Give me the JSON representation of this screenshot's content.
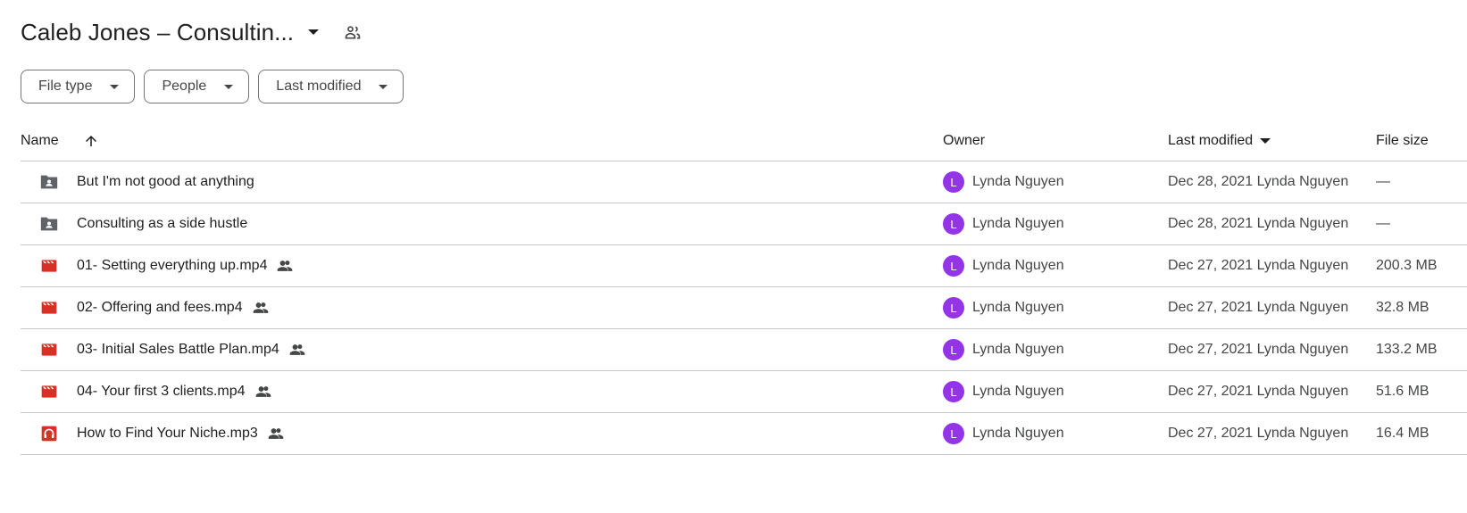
{
  "header": {
    "title": "Caleb Jones – Consultin...",
    "caret_icon": "arrow-drop-down-icon",
    "shared_icon": "shared-folder-icon"
  },
  "filters": [
    {
      "label": "File type",
      "icon": "arrow-drop-down-icon"
    },
    {
      "label": "People",
      "icon": "arrow-drop-down-icon"
    },
    {
      "label": "Last modified",
      "icon": "arrow-drop-down-icon"
    }
  ],
  "table": {
    "headers": {
      "name": "Name",
      "owner": "Owner",
      "last_modified": "Last modified",
      "file_size": "File size"
    },
    "sort_icon": "arrow-upward-icon",
    "rows": [
      {
        "icon": "shared-folder-icon",
        "name": "But I'm not good at anything",
        "shared": false,
        "owner_initial": "L",
        "owner": "Lynda Nguyen",
        "modified": "Dec 28, 2021 Lynda Nguyen",
        "size": "—"
      },
      {
        "icon": "shared-folder-icon",
        "name": "Consulting as a side hustle",
        "shared": false,
        "owner_initial": "L",
        "owner": "Lynda Nguyen",
        "modified": "Dec 28, 2021 Lynda Nguyen",
        "size": "—"
      },
      {
        "icon": "video-file-icon",
        "name": "01- Setting everything up.mp4",
        "shared": true,
        "owner_initial": "L",
        "owner": "Lynda Nguyen",
        "modified": "Dec 27, 2021 Lynda Nguyen",
        "size": "200.3 MB"
      },
      {
        "icon": "video-file-icon",
        "name": "02- Offering and fees.mp4",
        "shared": true,
        "owner_initial": "L",
        "owner": "Lynda Nguyen",
        "modified": "Dec 27, 2021 Lynda Nguyen",
        "size": "32.8 MB"
      },
      {
        "icon": "video-file-icon",
        "name": "03- Initial Sales Battle Plan.mp4",
        "shared": true,
        "owner_initial": "L",
        "owner": "Lynda Nguyen",
        "modified": "Dec 27, 2021 Lynda Nguyen",
        "size": "133.2 MB"
      },
      {
        "icon": "video-file-icon",
        "name": "04- Your first 3 clients.mp4",
        "shared": true,
        "owner_initial": "L",
        "owner": "Lynda Nguyen",
        "modified": "Dec 27, 2021 Lynda Nguyen",
        "size": "51.6 MB"
      },
      {
        "icon": "audio-file-icon",
        "name": "How to Find Your Niche.mp3",
        "shared": true,
        "owner_initial": "L",
        "owner": "Lynda Nguyen",
        "modified": "Dec 27, 2021 Lynda Nguyen",
        "size": "16.4 MB"
      }
    ]
  },
  "colors": {
    "avatar": "#9334e6",
    "video_icon": "#d93025",
    "folder_icon": "#5f6368",
    "divider": "#c7c7c7"
  }
}
